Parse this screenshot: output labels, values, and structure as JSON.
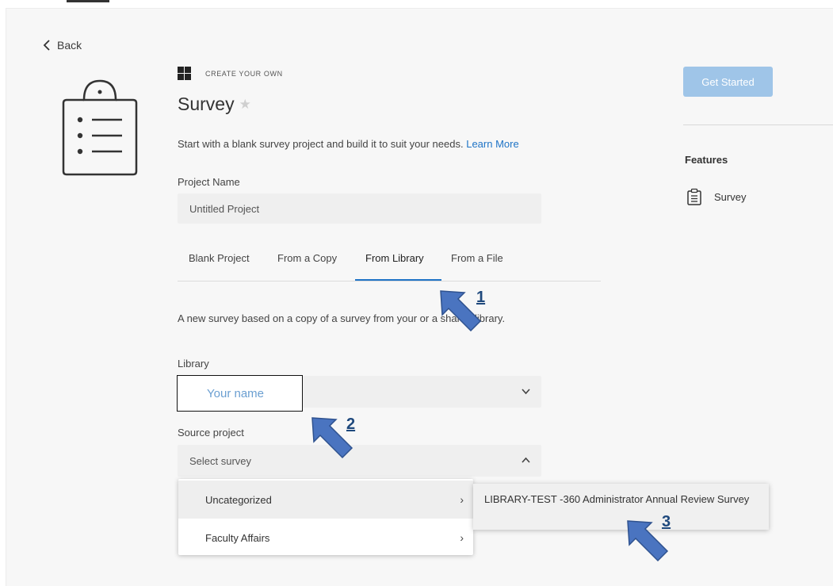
{
  "nav": {
    "back_label": "Back"
  },
  "header": {
    "eyebrow": "CREATE YOUR OWN",
    "title": "Survey",
    "description": "Start with a blank survey project and build it to suit your needs.",
    "learn_more": "Learn More"
  },
  "project_name": {
    "label": "Project Name",
    "value": "Untitled Project"
  },
  "tabs": [
    {
      "label": "Blank Project",
      "active": false
    },
    {
      "label": "From a Copy",
      "active": false
    },
    {
      "label": "From Library",
      "active": true
    },
    {
      "label": "From a File",
      "active": false
    }
  ],
  "library_section": {
    "info": "A new survey based on a copy of a survey from your or a shared library.",
    "library_label": "Library",
    "library_value": "Your name",
    "source_label": "Source project",
    "source_placeholder": "Select survey"
  },
  "dropdown": {
    "items": [
      {
        "label": "Uncategorized"
      },
      {
        "label": "Faculty Affairs"
      }
    ]
  },
  "submenu": {
    "item": "LIBRARY-TEST -360 Administrator Annual Review Survey"
  },
  "sidebar": {
    "get_started": "Get Started",
    "features_heading": "Features",
    "feature_item": "Survey"
  },
  "annotations": {
    "a1": "1",
    "a2": "2",
    "a3": "3"
  },
  "colors": {
    "accent": "#1f74c6",
    "button": "#9fc5e8",
    "arrow": "#4a74c0"
  }
}
